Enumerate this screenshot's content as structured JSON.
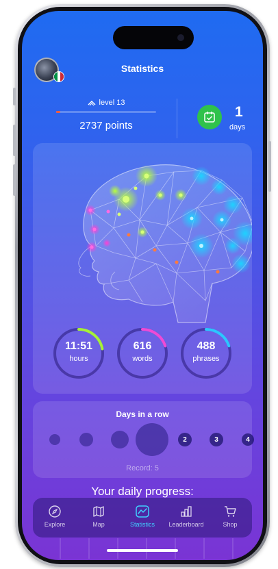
{
  "header": {
    "title": "Statistics",
    "flag_colors": [
      "#009246",
      "#ffffff",
      "#ce2b37"
    ]
  },
  "level": {
    "label": "level 13",
    "progress": 0.04,
    "points": "2737 points"
  },
  "streak": {
    "count": "1",
    "label": "days",
    "badge_color": "#2fc24b"
  },
  "stats": [
    {
      "value": "11:51",
      "label": "hours",
      "color": "#a6f03a",
      "progress": 0.22
    },
    {
      "value": "616",
      "label": "words",
      "color": "#ee4bd6",
      "progress": 0.2
    },
    {
      "value": "488",
      "label": "phrases",
      "color": "#2cc6ff",
      "progress": 0.2
    }
  ],
  "days_in_a_row": {
    "title": "Days in a row",
    "upcoming": [
      "2",
      "3",
      "4"
    ],
    "record": "Record: 5"
  },
  "daily_progress": {
    "title": "Your daily progress:"
  },
  "tabs": [
    {
      "label": "Explore",
      "icon": "compass-icon",
      "active": false
    },
    {
      "label": "Map",
      "icon": "map-icon",
      "active": false
    },
    {
      "label": "Statistics",
      "icon": "statistics-icon",
      "active": true
    },
    {
      "label": "Leaderboard",
      "icon": "leaderboard-icon",
      "active": false
    },
    {
      "label": "Shop",
      "icon": "cart-icon",
      "active": false
    }
  ],
  "colors": {
    "accent": "#3fd0ff",
    "green": "#a6f03a",
    "pink": "#ee4bd6",
    "cyan": "#2cc6ff",
    "orange": "#ff5b3d"
  }
}
